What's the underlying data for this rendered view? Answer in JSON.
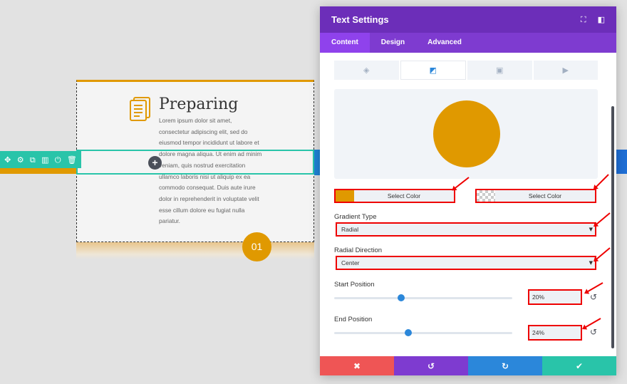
{
  "preview": {
    "title": "Preparing",
    "body": "Lorem ipsum dolor sit amet, consectetur adipiscing elit, sed do eiusmod tempor incididunt ut labore et dolore magna aliqua. Ut enim ad minim veniam, quis nostrud exercitation ullamco laboris nisi ut aliquip ex ea commodo consequat. Duis aute irure dolor in reprehenderit in voluptate velit esse cillum dolore eu fugiat nulla pariatur.",
    "number": "01",
    "add_glyph": "+",
    "row_toolbar": [
      {
        "icon": "move-icon",
        "glyph": "✥"
      },
      {
        "icon": "gear-icon",
        "glyph": "⚙"
      },
      {
        "icon": "duplicate-icon",
        "glyph": "⧉"
      },
      {
        "icon": "columns-icon",
        "glyph": "▥"
      },
      {
        "icon": "power-icon",
        "glyph": "⏻"
      },
      {
        "icon": "trash-icon",
        "glyph": "🗑"
      }
    ]
  },
  "panel": {
    "title": "Text Settings",
    "header_icons": [
      {
        "icon": "fullscreen-icon",
        "glyph": "⛶"
      },
      {
        "icon": "split-view-icon",
        "glyph": "◧"
      }
    ],
    "tabs": [
      {
        "label": "Content",
        "active": true
      },
      {
        "label": "Design",
        "active": false
      },
      {
        "label": "Advanced",
        "active": false
      }
    ],
    "background_tabs": [
      {
        "icon": "paint-bucket-icon",
        "glyph": "◈",
        "active": false
      },
      {
        "icon": "gradient-icon",
        "glyph": "◩",
        "active": true
      },
      {
        "icon": "image-icon",
        "glyph": "▣",
        "active": false
      },
      {
        "icon": "video-icon",
        "glyph": "▶",
        "active": false
      }
    ],
    "gradient": {
      "start_color": "#e09900",
      "start_color_label": "Select Color",
      "end_color": "transparent",
      "end_color_label": "Select Color",
      "type_label": "Gradient Type",
      "type_value": "Radial",
      "direction_label": "Radial Direction",
      "direction_value": "Center",
      "start_position_label": "Start Position",
      "start_position_value": "20%",
      "start_position": 0.2,
      "end_position_label": "End Position",
      "end_position_value": "24%",
      "end_position": 0.24
    },
    "footer": {
      "cancel_glyph": "✖",
      "undo_glyph": "↺",
      "redo_glyph": "↻",
      "save_glyph": "✔"
    }
  },
  "colors": {
    "purple_header": "#6c2eb9",
    "purple_tabs": "#7e3bd0",
    "accent_orange": "#e09900",
    "teal": "#29c4a9",
    "blue": "#2b87da",
    "red": "#ef5555",
    "highlight_red": "#ee0000"
  }
}
